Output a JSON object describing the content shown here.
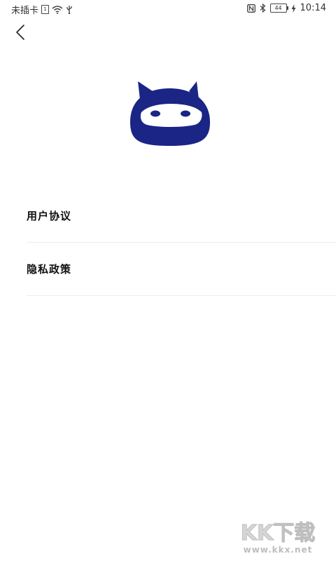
{
  "status_bar": {
    "carrier": "未插卡",
    "sim_label": "1",
    "battery_level": "44",
    "time": "10:14"
  },
  "menu": {
    "items": [
      {
        "label": "用户协议"
      },
      {
        "label": "隐私政策"
      }
    ]
  },
  "brand": {
    "logo_color": "#1a2585"
  },
  "watermark": {
    "main": "KK下载",
    "sub": "www.kkx.net"
  },
  "icons": {
    "back": "chevron-left-icon",
    "logo": "ninja-mascot-icon",
    "wifi": "wifi-icon",
    "usb": "usb-icon",
    "nfc": "nfc-icon",
    "bluetooth": "bluetooth-icon",
    "charging": "bolt-icon"
  }
}
